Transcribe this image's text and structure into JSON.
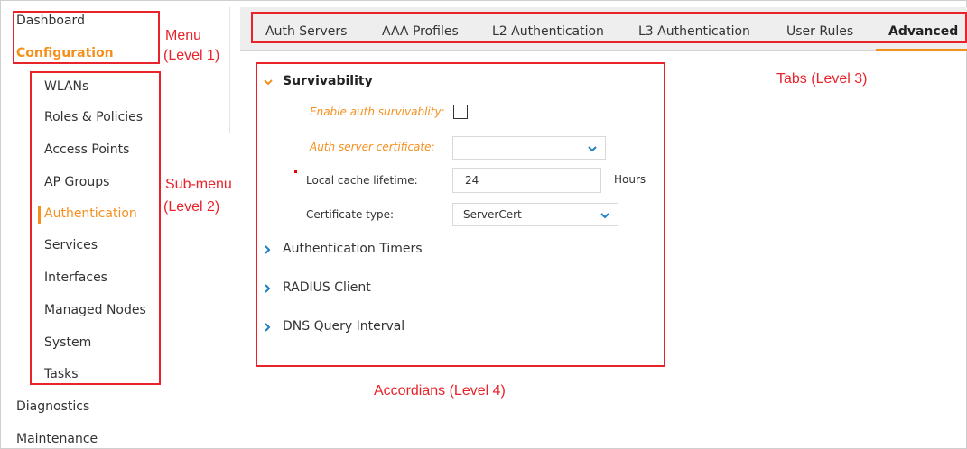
{
  "menu": {
    "items": [
      {
        "label": "Dashboard"
      },
      {
        "label": "Configuration"
      },
      {
        "label": "Diagnostics"
      },
      {
        "label": "Maintenance"
      }
    ],
    "active_index": 1
  },
  "submenu": {
    "items": [
      {
        "label": "WLANs"
      },
      {
        "label": "Roles & Policies"
      },
      {
        "label": "Access Points"
      },
      {
        "label": "AP Groups"
      },
      {
        "label": "Authentication"
      },
      {
        "label": "Services"
      },
      {
        "label": "Interfaces"
      },
      {
        "label": "Managed Nodes"
      },
      {
        "label": "System"
      },
      {
        "label": "Tasks"
      }
    ],
    "active_index": 4
  },
  "tabs": {
    "items": [
      {
        "label": "Auth Servers"
      },
      {
        "label": "AAA Profiles"
      },
      {
        "label": "L2 Authentication"
      },
      {
        "label": "L3 Authentication"
      },
      {
        "label": "User Rules"
      },
      {
        "label": "Advanced"
      }
    ],
    "active_index": 5
  },
  "accordions": {
    "survivability": {
      "title": "Survivability",
      "expanded": true,
      "fields": {
        "enable_auth_label": "Enable auth survivablity:",
        "enable_auth_checked": false,
        "auth_cert_label": "Auth server certificate:",
        "auth_cert_value": "",
        "cache_label": "Local cache lifetime:",
        "cache_value": "24",
        "cache_unit": "Hours",
        "cert_type_label": "Certificate type:",
        "cert_type_value": "ServerCert"
      }
    },
    "collapsed": [
      {
        "title": "Authentication Timers"
      },
      {
        "title": "RADIUS Client"
      },
      {
        "title": "DNS Query Interval"
      }
    ]
  },
  "annotations": {
    "menu_line1": "Menu",
    "menu_line2": "(Level 1)",
    "submenu_line1": "Sub-menu",
    "submenu_line2": "(Level 2)",
    "tabs": "Tabs (Level 3)",
    "accordions": "Accordians (Level 4)"
  },
  "colors": {
    "accent": "#f5901e",
    "annotation": "#e8232a",
    "link_chevron": "#1f7fc2"
  }
}
